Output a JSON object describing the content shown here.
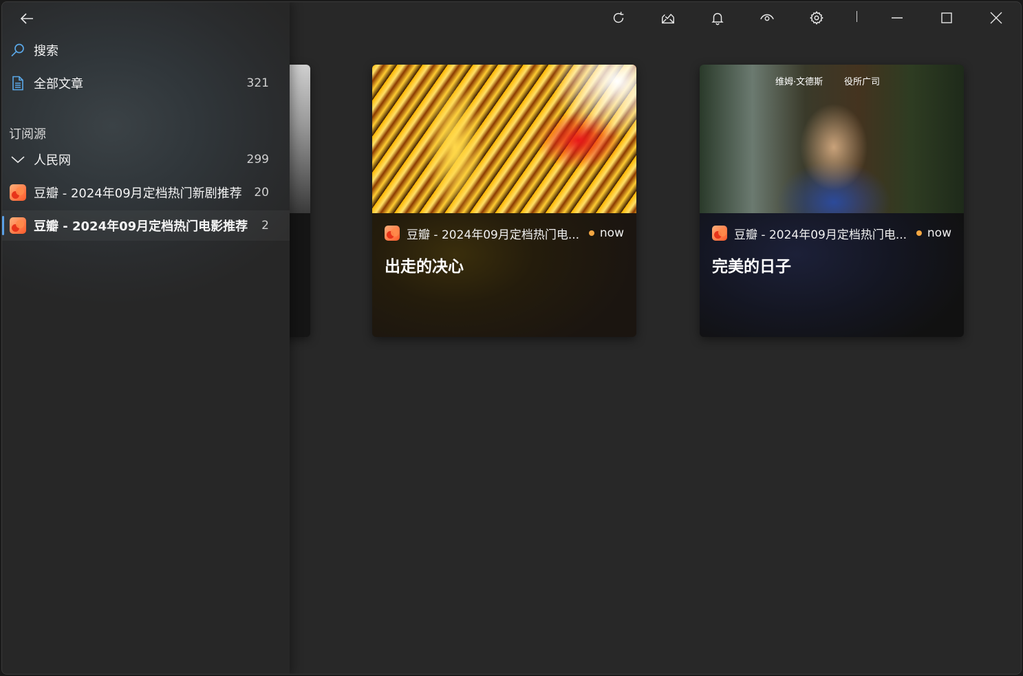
{
  "sidebar": {
    "search_label": "搜索",
    "all_articles": {
      "label": "全部文章",
      "count": "321"
    },
    "section_title": "订阅源",
    "groups": [
      {
        "label": "人民网",
        "count": "299"
      }
    ],
    "feeds": [
      {
        "label": "豆瓣 - 2024年09月定档热门新剧推荐",
        "count": "20"
      },
      {
        "label": "豆瓣 - 2024年09月定档热门电影推荐",
        "count": "2",
        "active": true
      }
    ]
  },
  "cards": [
    {
      "source": "豆瓣 - 2024年09月定档热门电...",
      "time": "now",
      "title": "出走的决心"
    },
    {
      "source": "豆瓣 - 2024年09月定档热门电...",
      "time": "now",
      "title": "完美的日子",
      "poster_text_1": "维姆·文德斯",
      "poster_text_2": "役所广司"
    }
  ],
  "colors": {
    "unread_dot": "#f5a742",
    "active_indicator": "#5aa0e6",
    "feed_icon": "#ff5a2a"
  }
}
